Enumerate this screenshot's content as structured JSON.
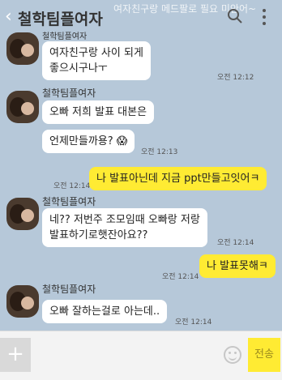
{
  "header": {
    "back_icon": "‹",
    "title": "철학팀플여자",
    "banner": "여자친구랑 메드팔로 필요 미안어~",
    "search_icon": "search-icon",
    "menu_icon": "more-vertical-icon"
  },
  "messages": [
    {
      "type": "them",
      "name": "철학팀플여자",
      "lines": [
        "여자친구랑 사이 되게",
        "좋으시구나ㅜ"
      ],
      "time": "오전 12:12"
    },
    {
      "type": "them",
      "name": "철학팀플여자",
      "lines": [
        "오빠 저희 발표 대본은"
      ],
      "time": ""
    },
    {
      "type": "them",
      "name": "",
      "lines": [
        "언제만들까용? 😱"
      ],
      "time": "오전 12:13"
    },
    {
      "type": "me",
      "lines": [
        "나 발표아닌데 지금 ppt만들고잇어ㅋ"
      ],
      "time": "오전 12:14"
    },
    {
      "type": "them",
      "name": "철학팀플여자",
      "lines": [
        "네?? 저번주 조모임때 오빠랑 저랑",
        "발표하기로햇잔아요??"
      ],
      "time": "오전 12:14"
    },
    {
      "type": "me",
      "lines": [
        "나 발표못해ㅋ"
      ],
      "time": "오전 12:14"
    },
    {
      "type": "them",
      "name": "철학팀플여자",
      "lines": [
        "오빠 잘하는걸로 아는데.."
      ],
      "time": "오전 12:14"
    }
  ],
  "input": {
    "plus_label": "+",
    "send_label": "전송",
    "emoji_icon": "emoji-icon"
  }
}
